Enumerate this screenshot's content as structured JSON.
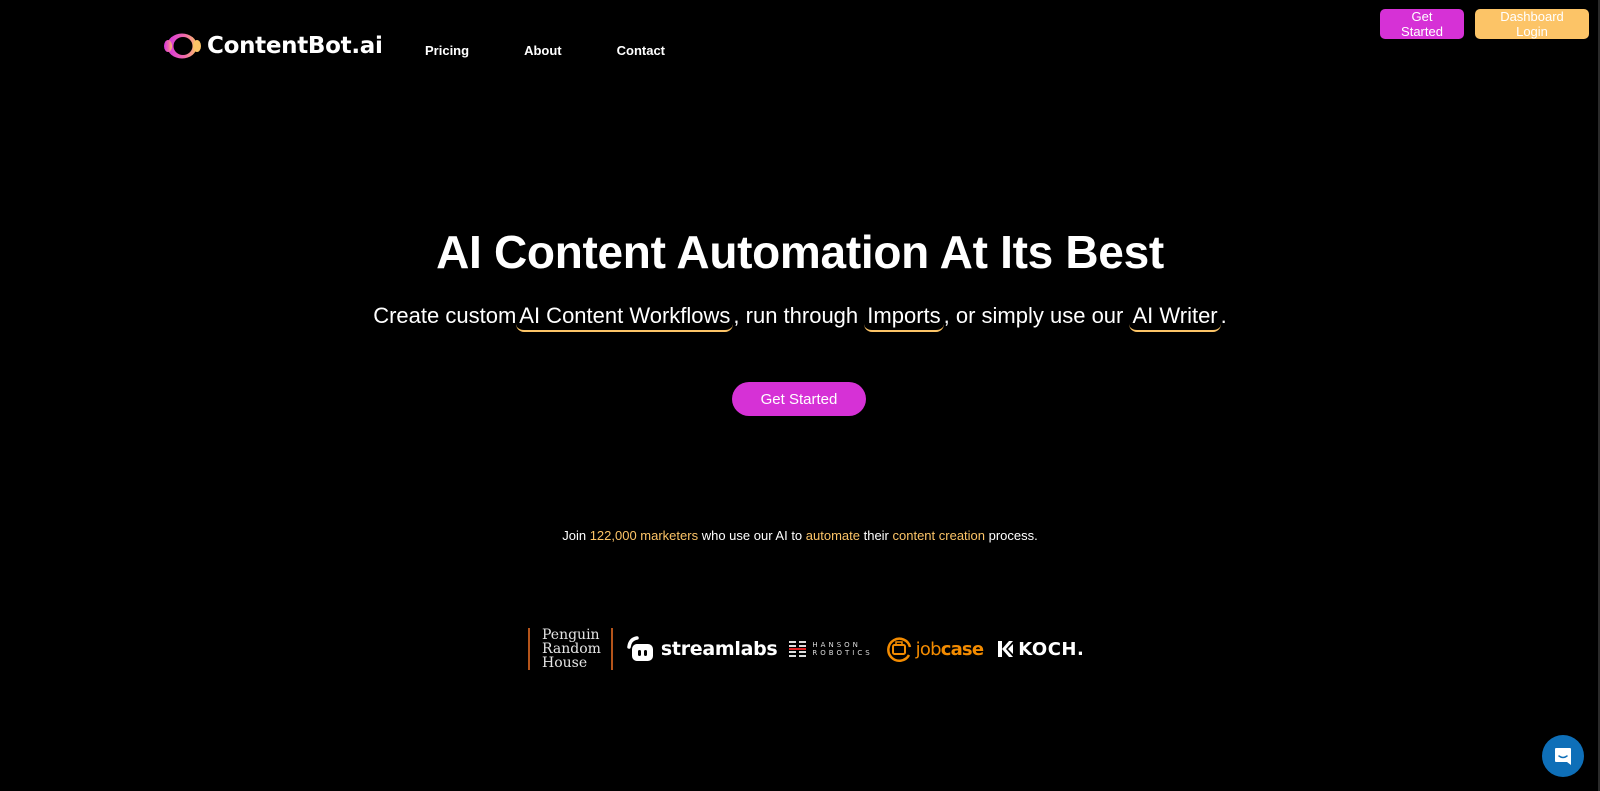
{
  "header": {
    "logo_text": "ContentBot.ai",
    "nav": [
      {
        "label": "Pricing"
      },
      {
        "label": "About"
      },
      {
        "label": "Contact"
      }
    ],
    "actions": {
      "get_started": "Get Started",
      "dashboard_login": "Dashboard Login"
    }
  },
  "hero": {
    "title": "AI Content Automation At Its Best",
    "subtitle": {
      "part1": "Create custom",
      "link1": "AI Content Workflows",
      "part2": ", run through ",
      "link2": "Imports",
      "part3": ", or simply use our ",
      "link3": "AI Writer",
      "part4": "."
    },
    "cta_label": "Get Started"
  },
  "social_proof": {
    "t1": "Join ",
    "count": "122,000 marketers",
    "t2": " who use our AI to ",
    "h2": "automate",
    "t3": " their ",
    "h3": "content creation",
    "t4": " process."
  },
  "client_logos": {
    "penguin": [
      "Penguin",
      "Random",
      "House"
    ],
    "streamlabs": "streamlabs",
    "hanson": [
      "HANSON",
      "ROBOTICS"
    ],
    "jobcase_job": "job",
    "jobcase_case": "case",
    "koch": "KOCH."
  },
  "colors": {
    "brand_pink": "#d631d6",
    "brand_gold": "#fcc467",
    "chat_blue": "#0e6fb8",
    "background": "#000000"
  },
  "chat": {
    "icon": "chat-bubble-icon"
  }
}
